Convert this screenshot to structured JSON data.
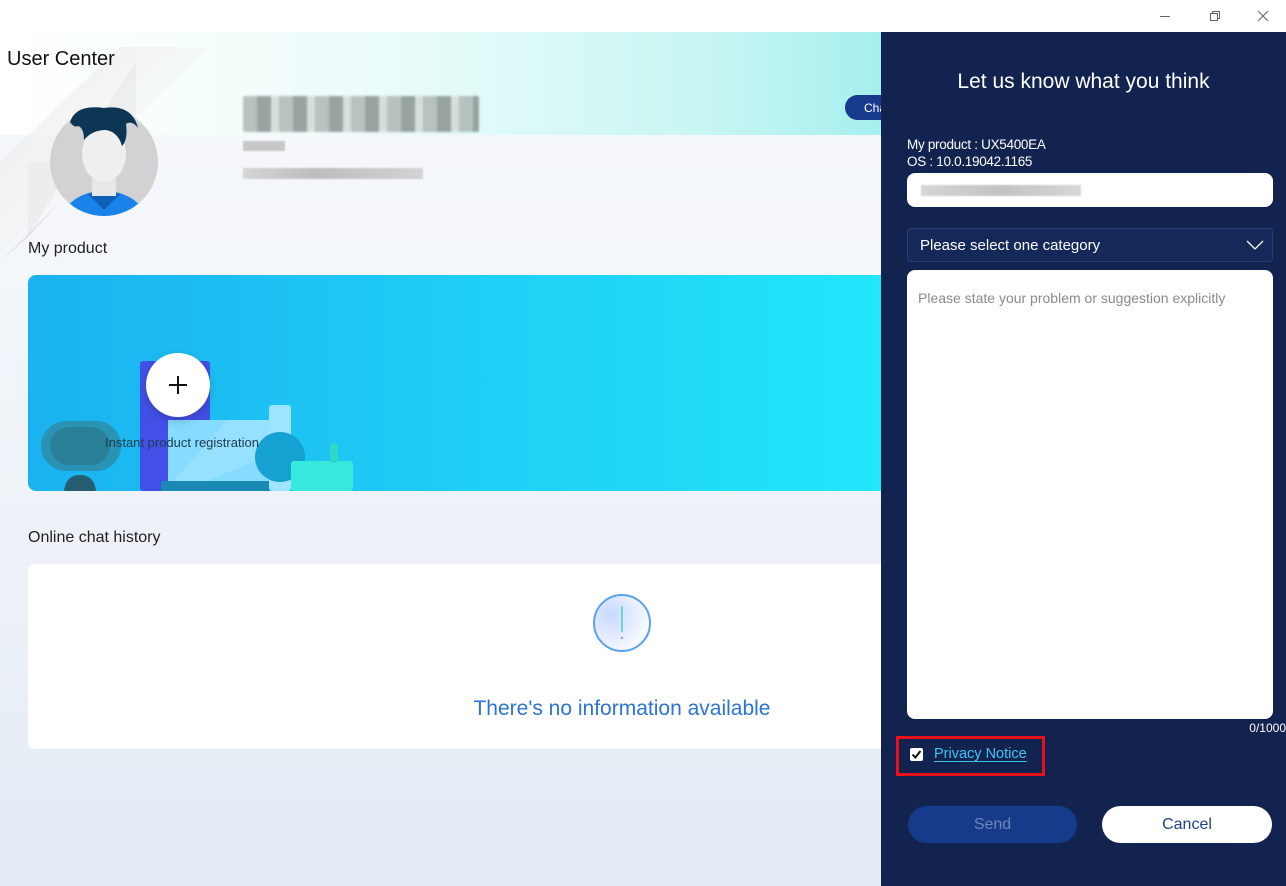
{
  "window": {
    "controls": {
      "minimize": "minimize-icon",
      "restore": "restore-icon",
      "close": "close-icon"
    }
  },
  "user_center": {
    "title": "User Center",
    "profile": {
      "name": "[redacted]",
      "region": "[redacted]",
      "email": "[redacted]",
      "change_button": "Change"
    },
    "my_product": {
      "label": "My product",
      "register_label": "Instant product registration",
      "add_icon": "plus-icon"
    },
    "chat_history": {
      "label": "Online chat history",
      "empty_icon": "exclamation-circle-icon",
      "empty_text": "There's no information available"
    }
  },
  "feedback": {
    "title": "Let us know what you think",
    "product_line": "My product : UX5400EA",
    "os_line": "OS : 10.0.19042.1165",
    "email_value": "[redacted]",
    "category_select": {
      "selected": "Please select one category"
    },
    "problem_placeholder": "Please state your problem or suggestion explicitly",
    "problem_value": "",
    "counter": "0/1000",
    "privacy": {
      "checked": true,
      "label": "Privacy Notice"
    },
    "send_label": "Send",
    "cancel_label": "Cancel"
  },
  "colors": {
    "panel_bg": "#13234f",
    "link": "#3ec4f2",
    "highlight_box": "#e8111a",
    "empty_text": "#2b74d6",
    "send_disabled_bg": "#163b8b"
  }
}
